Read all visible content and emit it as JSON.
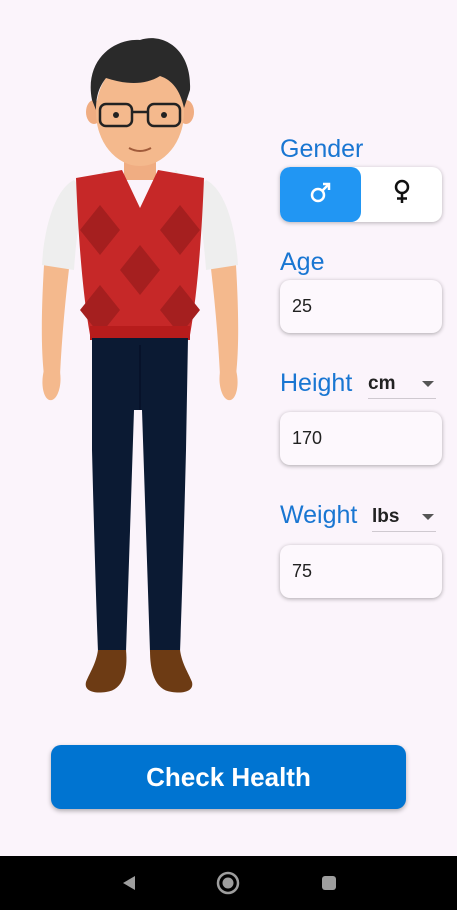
{
  "form": {
    "gender_label": "Gender",
    "gender_options": [
      {
        "symbol": "♂",
        "name": "male",
        "selected": true
      },
      {
        "symbol": "♀",
        "name": "female",
        "selected": false
      }
    ],
    "age_label": "Age",
    "age_value": "25",
    "height_label": "Height",
    "height_unit": "cm",
    "height_value": "170",
    "weight_label": "Weight",
    "weight_unit": "lbs",
    "weight_value": "75"
  },
  "actions": {
    "check_health_label": "Check Health"
  },
  "colors": {
    "background": "#fbf4fb",
    "accent": "#1976d2",
    "toggle_active": "#2196f3",
    "button": "#0074d1"
  },
  "icons": {
    "male": "male-symbol-icon",
    "female": "female-symbol-icon",
    "nav_back": "back-triangle-icon",
    "nav_home": "home-circle-icon",
    "nav_recents": "recents-square-icon"
  }
}
